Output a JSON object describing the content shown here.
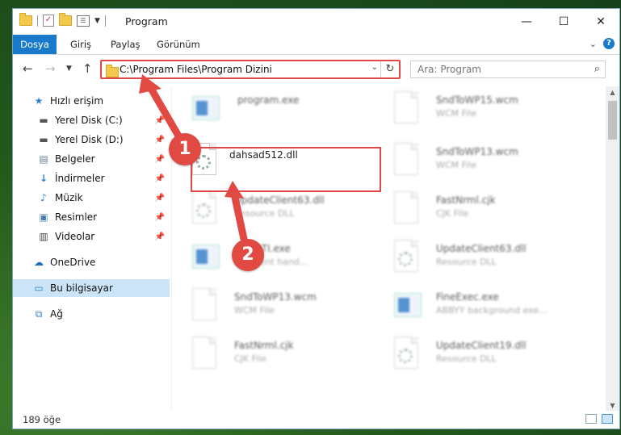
{
  "window": {
    "title": "Program"
  },
  "ribbon": {
    "tabs": [
      "Dosya",
      "Giriş",
      "Paylaş",
      "Görünüm"
    ],
    "active_tab": "Dosya"
  },
  "address": {
    "path": "C:\\Program Files\\Program Dizini"
  },
  "search": {
    "placeholder": "Ara: Program"
  },
  "sidebar": {
    "items": [
      {
        "label": "Hızlı erişim",
        "icon": "star-icon"
      },
      {
        "label": "Yerel Disk (C:)",
        "icon": "drive-icon",
        "pinned": true
      },
      {
        "label": "Yerel Disk (D:)",
        "icon": "drive-icon",
        "pinned": true
      },
      {
        "label": "Belgeler",
        "icon": "document-icon",
        "pinned": true
      },
      {
        "label": "İndirmeler",
        "icon": "download-icon",
        "pinned": true
      },
      {
        "label": "Müzik",
        "icon": "music-icon",
        "pinned": true
      },
      {
        "label": "Resimler",
        "icon": "pictures-icon",
        "pinned": true
      },
      {
        "label": "Videolar",
        "icon": "video-icon",
        "pinned": true
      },
      {
        "label": "OneDrive",
        "icon": "cloud-icon"
      },
      {
        "label": "Bu bilgisayar",
        "icon": "computer-icon",
        "selected": true
      },
      {
        "label": "Ağ",
        "icon": "network-icon"
      }
    ]
  },
  "files": [
    {
      "name": "program.exe",
      "type": "",
      "icon": "app-icon"
    },
    {
      "name": "SndToWP15.wcm",
      "type": "WCM File",
      "icon": "document-icon"
    },
    {
      "name": "dahsad512.dll",
      "type": "",
      "icon": "dll-icon",
      "highlighted": true
    },
    {
      "name": "SndToWP13.wcm",
      "type": "WCM File",
      "icon": "document-icon"
    },
    {
      "name": "UpdateClient63.dll",
      "type": "Resource DLL",
      "icon": "dll-icon"
    },
    {
      "name": "FastNrml.cjk",
      "type": "CJK File",
      "icon": "document-icon"
    },
    {
      "name": "...pySTI.exe",
      "type": "...t event hand...",
      "icon": "app-icon"
    },
    {
      "name": "UpdateClient63.dll",
      "type": "Resource DLL",
      "icon": "dll-icon"
    },
    {
      "name": "SndToWP13.wcm",
      "type": "WCM File",
      "icon": "document-icon"
    },
    {
      "name": "FineExec.exe",
      "type": "ABBYY background exe...",
      "icon": "app-icon"
    },
    {
      "name": "FastNrml.cjk",
      "type": "CJK File",
      "icon": "document-icon"
    },
    {
      "name": "UpdateClient19.dll",
      "type": "Resource DLL",
      "icon": "dll-icon"
    }
  ],
  "status": {
    "item_count": "189 öğe"
  },
  "annotations": {
    "step1": "1",
    "step2": "2",
    "color": "#e14a43"
  }
}
